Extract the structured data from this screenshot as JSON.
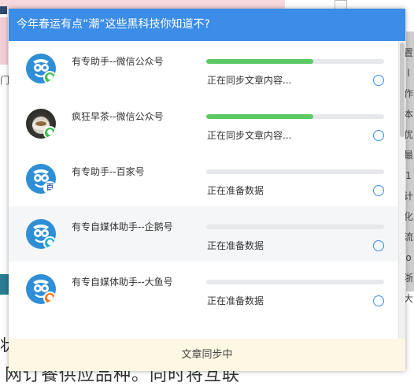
{
  "dialog": {
    "title": "今年春运有点“潮”这些黑科技你知道不?",
    "footer_status": "文章同步中",
    "accounts": [
      {
        "name": "有专助手--微信公众号",
        "status": "正在同步文章内容...",
        "progress": 0.6,
        "avatar_icon": "robot-logo-icon",
        "badge_icon": "wechat-icon",
        "highlighted": false
      },
      {
        "name": "疯狂早茶--微信公众号",
        "status": "正在同步文章内容...",
        "progress": 0.6,
        "avatar_icon": "teacup-photo-icon",
        "badge_icon": "wechat-icon",
        "highlighted": false
      },
      {
        "name": "有专助手--百家号",
        "status": "正在准备数据",
        "progress": 0,
        "avatar_icon": "robot-logo-icon",
        "badge_icon": "baijiahao-icon",
        "highlighted": false
      },
      {
        "name": "有专自媒体助手--企鹅号",
        "status": "正在准备数据",
        "progress": 0,
        "avatar_icon": "robot-logo-icon",
        "badge_icon": "penguin-icon",
        "highlighted": true
      },
      {
        "name": "有专自媒体助手--大鱼号",
        "status": "正在准备数据",
        "progress": 0,
        "avatar_icon": "robot-logo-icon",
        "badge_icon": "dayu-icon",
        "highlighted": false
      }
    ]
  },
  "background": {
    "left_text": "门",
    "big_char": "状",
    "bottom_text": "网订餐供应品种。同时将互联",
    "side_glyphs": [
      "置",
      "l",
      "作",
      "本",
      "优",
      "最",
      "1",
      "计",
      "化",
      "流",
      "o",
      "浙",
      "大"
    ]
  },
  "colors": {
    "header": "#3b8de8",
    "progress_fill": "#5cc964",
    "footer_bg": "#fdf7e3"
  }
}
